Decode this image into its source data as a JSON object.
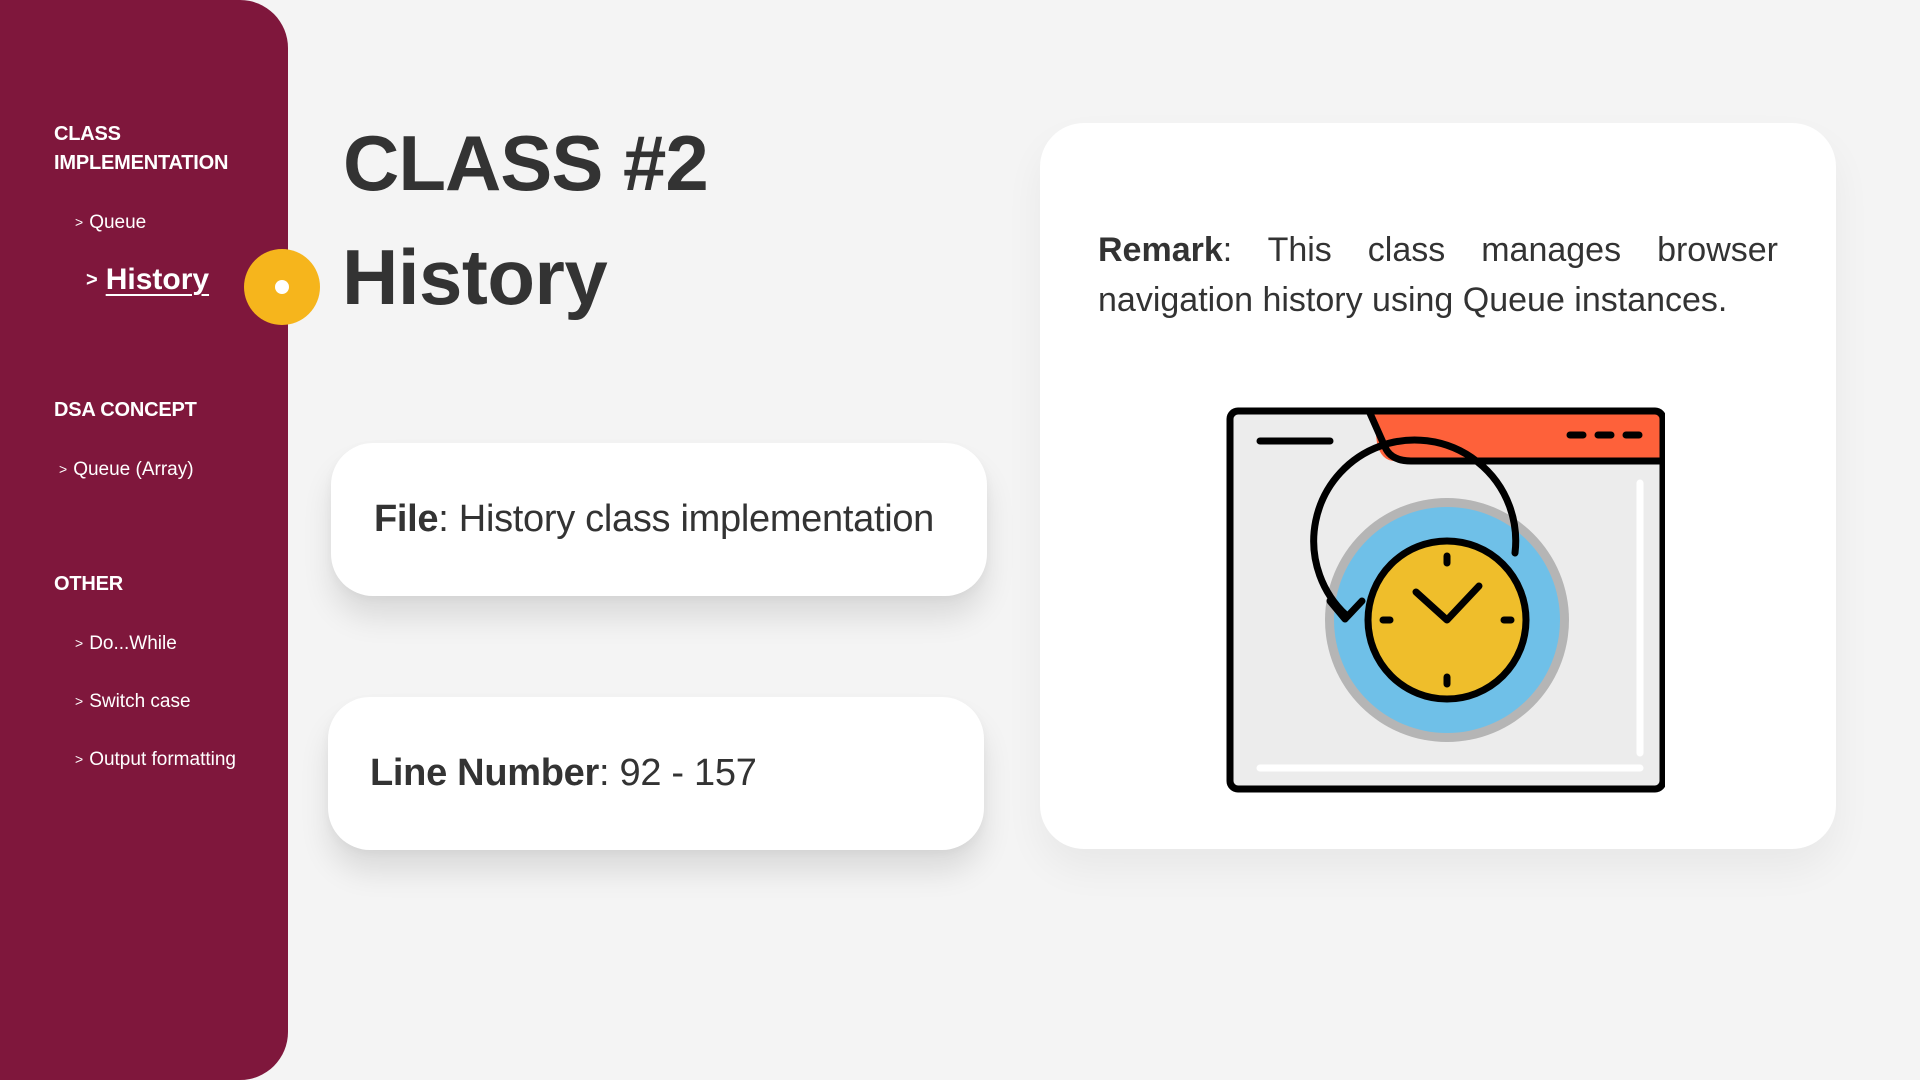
{
  "sidebar": {
    "sections": [
      {
        "title_lines": [
          "CLASS",
          "IMPLEMENTATION"
        ],
        "items": [
          {
            "chevron": ">",
            "label": "Queue"
          },
          {
            "chevron": ">",
            "label": "History"
          }
        ]
      },
      {
        "title": "DSA CONCEPT",
        "items": [
          {
            "chevron": ">",
            "label": "Queue (Array)"
          }
        ]
      },
      {
        "title": "OTHER",
        "items": [
          {
            "chevron": ">",
            "label": "Do...While"
          },
          {
            "chevron": ">",
            "label": "Switch case"
          },
          {
            "chevron": ">",
            "label": "Output formatting"
          }
        ]
      }
    ],
    "active_item": "History"
  },
  "header": {
    "title": "CLASS #2",
    "subtitle": "History"
  },
  "cards": {
    "file": {
      "label": "File",
      "separator": ":",
      "value": "History class implementation"
    },
    "line_number": {
      "label": "Line Number",
      "separator": ":",
      "value": "92 - 157"
    }
  },
  "remark": {
    "label": "Remark",
    "separator": ":",
    "text": "This class manages browser navigation history using Queue instances."
  },
  "illustration": {
    "icon": "browser-history-clock-icon"
  },
  "colors": {
    "sidebar": "#7f173c",
    "marker": "#f6b51c",
    "background": "#f4f4f4",
    "text": "#333333",
    "window_bar": "#fe613a",
    "clock_ring": "#6fc0e8",
    "clock_face": "#efbe2b"
  }
}
